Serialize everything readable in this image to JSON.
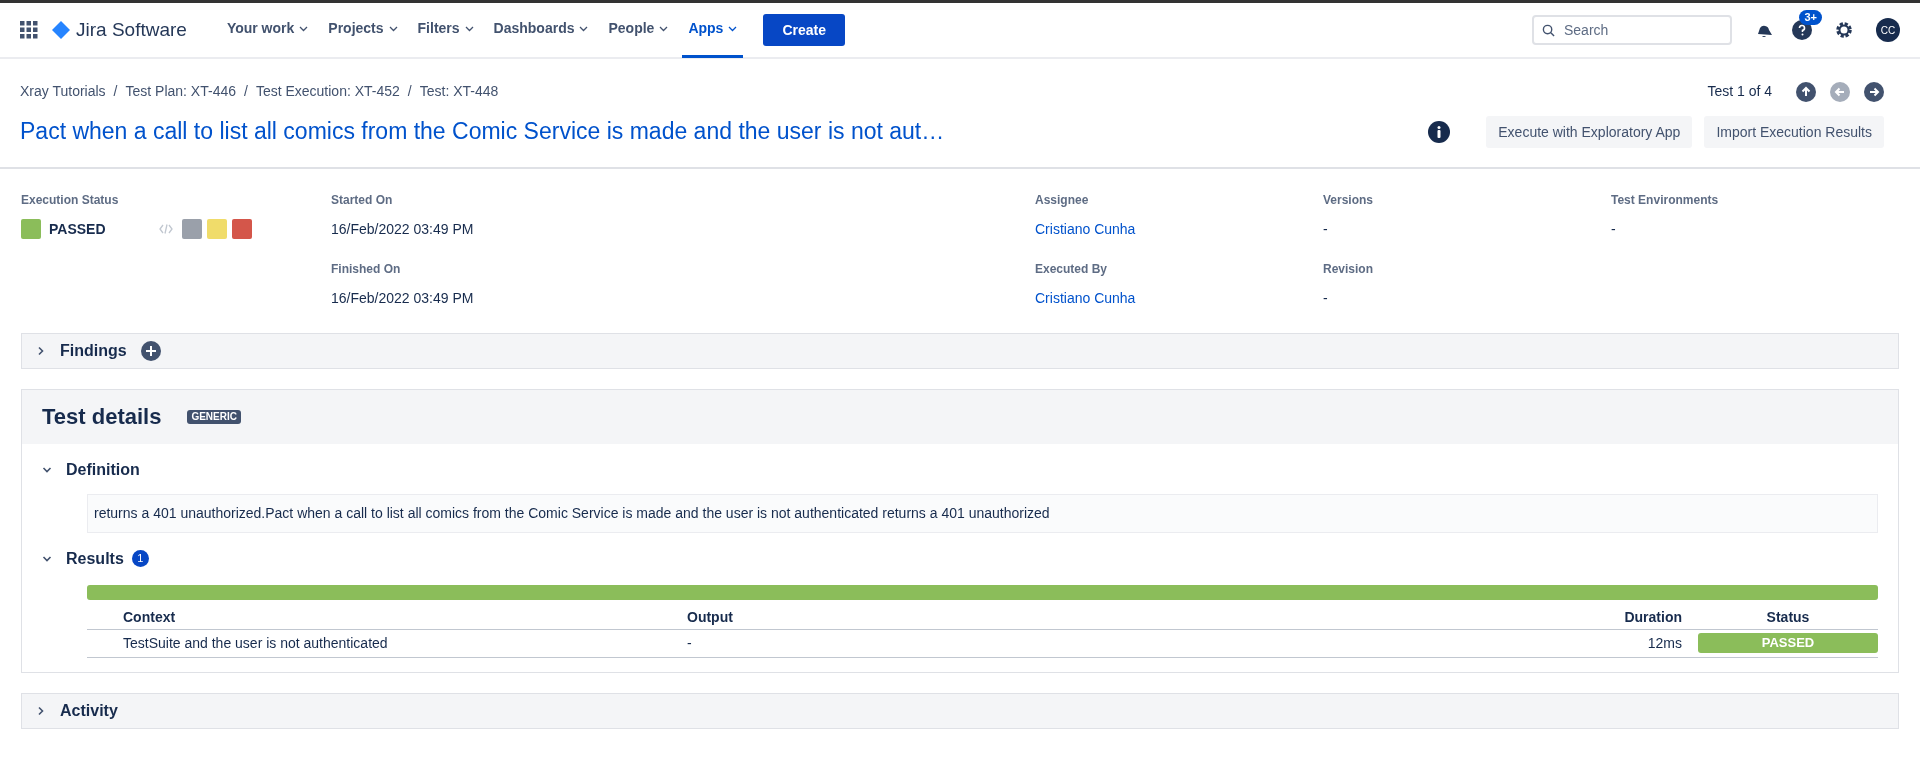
{
  "nav": {
    "brand": "Jira Software",
    "items": [
      {
        "label": "Your work",
        "selected": false
      },
      {
        "label": "Projects",
        "selected": false
      },
      {
        "label": "Filters",
        "selected": false
      },
      {
        "label": "Dashboards",
        "selected": false
      },
      {
        "label": "People",
        "selected": false
      },
      {
        "label": "Apps",
        "selected": true
      }
    ],
    "create": "Create",
    "search": {
      "placeholder": "Search"
    },
    "help_badge": "3+",
    "avatar": "CC"
  },
  "breadcrumbs": {
    "separator": "/",
    "items": [
      "Xray Tutorials",
      "Test Plan: XT-446",
      "Test Execution: XT-452",
      "Test: XT-448"
    ]
  },
  "title": "Pact when a call to list all comics from the Comic Service is made and the user is not aut…",
  "pager": {
    "label": "Test 1 of 4",
    "buttons": [
      {
        "kind": "up",
        "disabled": false
      },
      {
        "kind": "prev",
        "disabled": true
      },
      {
        "kind": "next",
        "disabled": false
      }
    ]
  },
  "actions": [
    "Execute with Exploratory App",
    "Import Execution Results"
  ],
  "execution_status": {
    "label": "Execution Status",
    "value": "PASSED",
    "color": "#8bbd5a",
    "options": [
      {
        "color": "#9aa0aa"
      },
      {
        "color": "#f0dc6a"
      },
      {
        "color": "#d4564a"
      }
    ]
  },
  "fields": [
    {
      "label": "Started On",
      "value": "16/Feb/2022 03:49 PM",
      "kind": "text"
    },
    {
      "label": "Assignee",
      "value": "Cristiano Cunha",
      "kind": "link"
    },
    {
      "label": "Versions",
      "value": "-",
      "kind": "text"
    },
    {
      "label": "Test Environments",
      "value": "-",
      "kind": "text"
    },
    {
      "label": "Finished On",
      "value": "16/Feb/2022 03:49 PM",
      "kind": "text"
    },
    {
      "label": "Executed By",
      "value": "Cristiano Cunha",
      "kind": "link"
    },
    {
      "label": "Revision",
      "value": "-",
      "kind": "text"
    }
  ],
  "findings": {
    "title": "Findings",
    "expanded": false
  },
  "test_details": {
    "title": "Test details",
    "badge": "GENERIC",
    "definition": {
      "title": "Definition",
      "expanded": true,
      "text": "returns a 401 unauthorized.Pact when a call to list all comics from the Comic Service is made and the user is not authenticated returns a 401 unauthorized"
    },
    "results": {
      "title": "Results",
      "expanded": true,
      "count": "1",
      "progress": {
        "level": 1,
        "color": "#8bbd5a"
      },
      "columns": [
        "Context",
        "Output",
        "Duration",
        "Status"
      ],
      "rows": [
        {
          "context": "TestSuite and the user is not authenticated",
          "output": "-",
          "duration": "12ms",
          "status": "PASSED",
          "color": "#8bbd5a"
        }
      ]
    }
  },
  "activity": {
    "title": "Activity",
    "expanded": false
  }
}
